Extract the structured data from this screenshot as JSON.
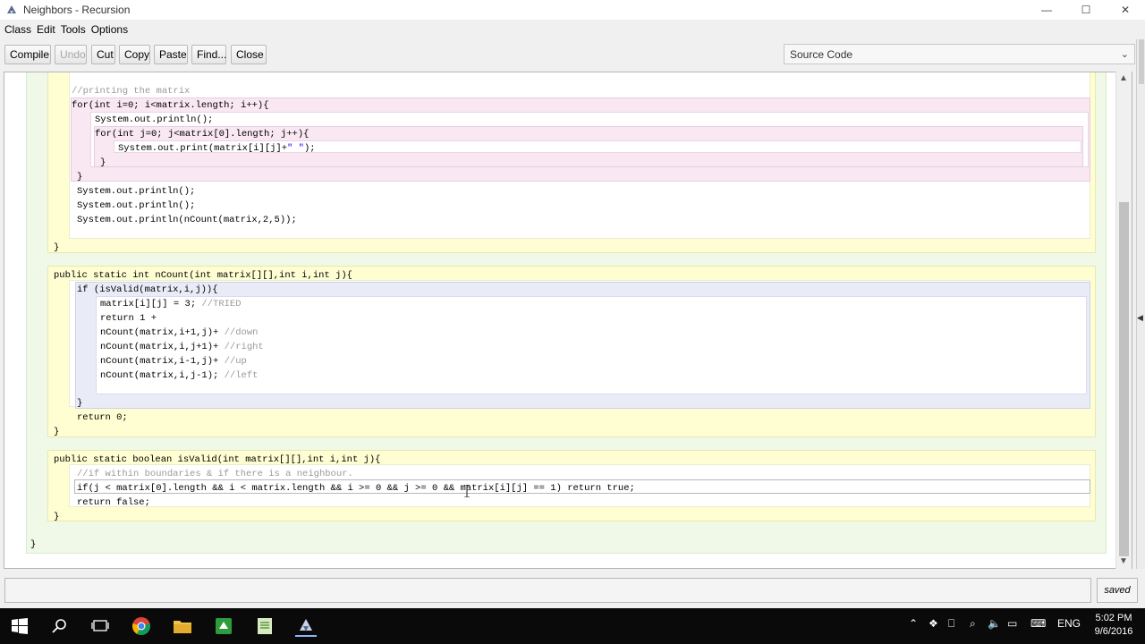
{
  "window": {
    "title": "Neighbors - Recursion",
    "controls": {
      "minimize": "—",
      "maximize": "☐",
      "close": "✕"
    }
  },
  "menu": [
    "Class",
    "Edit",
    "Tools",
    "Options"
  ],
  "toolbar": {
    "compile": "Compile",
    "undo": "Undo",
    "cut": "Cut",
    "copy": "Copy",
    "paste": "Paste",
    "find": "Find...",
    "close": "Close",
    "view_selected": "Source Code"
  },
  "code": {
    "main_tail": {
      "comment": "//printing the matrix",
      "for_outer": "for(int i=0; i<matrix.length; i++){",
      "println_blank": "System.out.println();",
      "for_inner": "for(int j=0; j<matrix[0].length; j++){",
      "print_cell_pre": "System.out.print(matrix[i][j]+",
      "print_cell_str": "\" \"",
      "print_cell_post": ");",
      "close_inner": "}",
      "close_outer": "}",
      "println_1": "System.out.println();",
      "println_2": "System.out.println();",
      "println_count": "System.out.println(nCount(matrix,2,5));",
      "close_main": "}"
    },
    "ncount": {
      "signature": "public static int nCount(int matrix[][],int i,int j){",
      "if_line": "if (isValid(matrix,i,j)){",
      "set_line": "matrix[i][j] = 3; ",
      "set_comment": "//TRIED",
      "return_line": "return 1 +",
      "down": "nCount(matrix,i+1,j)+ ",
      "down_cm": "//down",
      "right": "nCount(matrix,i,j+1)+ ",
      "right_cm": "//right",
      "up": "nCount(matrix,i-1,j)+ ",
      "up_cm": "//up",
      "left": "nCount(matrix,i,j-1); ",
      "left_cm": "//left",
      "close_if": "}",
      "return_zero": "return 0;",
      "close_method": "}"
    },
    "isvalid": {
      "signature": "public static boolean isValid(int matrix[][],int i,int j){",
      "comment": "//if within boundaries & if there is a neighbour.",
      "if_line": "if(j < matrix[0].length && i < matrix.length && i >= 0 && j >= 0 && matrix[i][j] == 1) return true;",
      "return_false": "return false;",
      "close_method": "}"
    },
    "close_class": "}"
  },
  "status": {
    "message": "",
    "saved": "saved"
  },
  "taskbar": {
    "language": "ENG",
    "time": "5:02 PM",
    "date": "9/6/2016"
  }
}
